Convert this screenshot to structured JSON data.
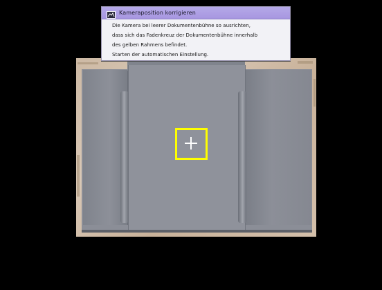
{
  "dialog": {
    "title": "Kameraposition korrigieren",
    "icon": "camera-stage-icon",
    "lines": [
      "Die Kamera bei leerer Dokumentenbühne so ausrichten,",
      "dass sich das Fadenkreuz der Dokumentenbühne innerhalb",
      "des gelben Rahmens befindet.",
      "Starten der automatischen Einstellung."
    ]
  },
  "colors": {
    "background": "#000000",
    "title_bar": "#a99ae2",
    "frame": "#ffff00",
    "crosshair": "#ffffff",
    "stage": "#8f929b"
  }
}
